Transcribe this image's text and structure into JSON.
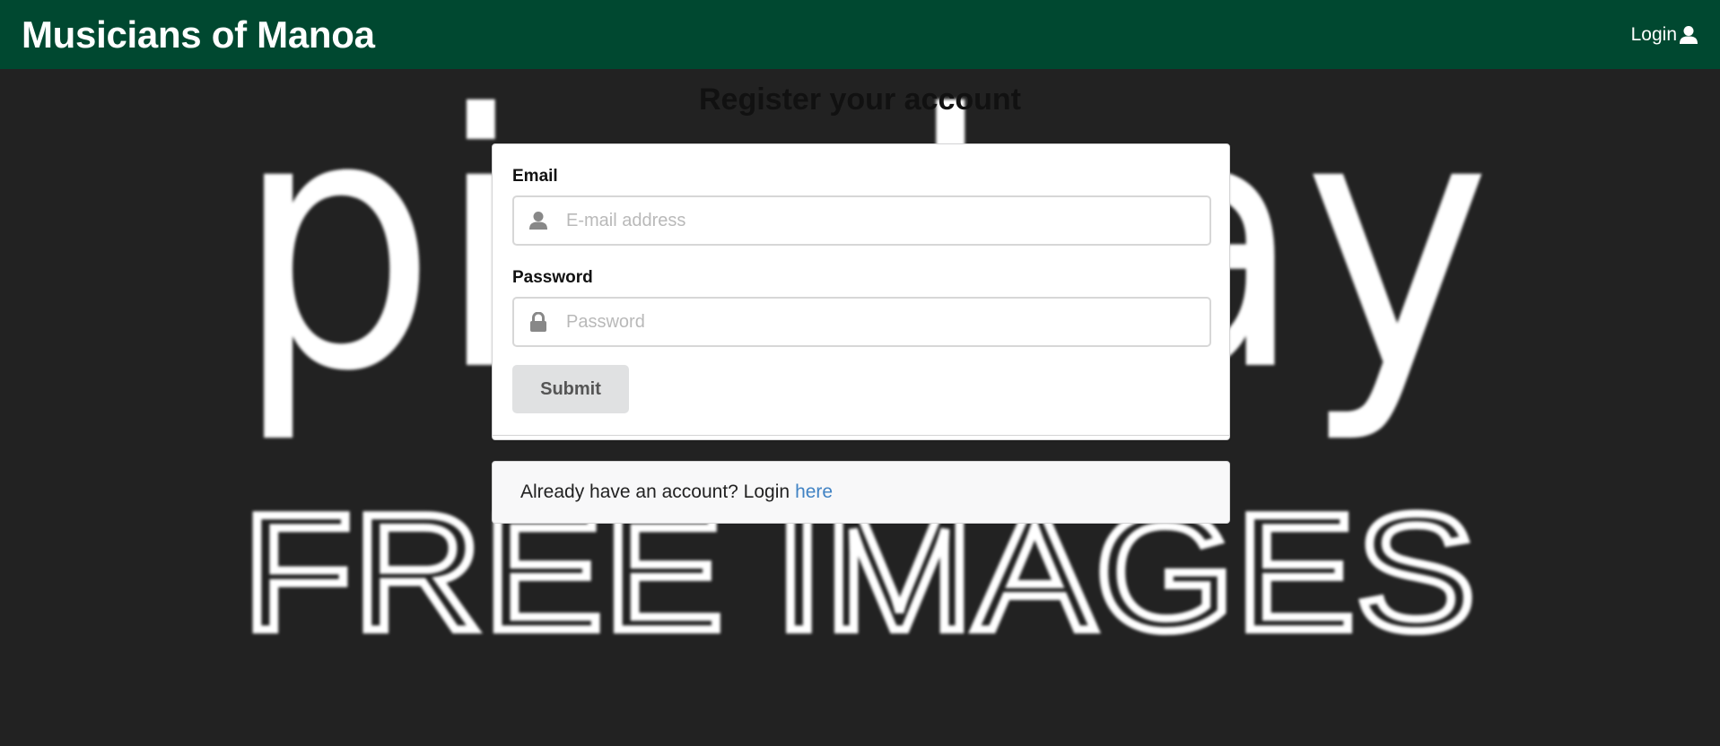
{
  "navbar": {
    "brand": "Musicians of Manoa",
    "login_label": "Login"
  },
  "background": {
    "watermark_top": "pixabay",
    "watermark_bottom": "FREE IMAGES"
  },
  "page": {
    "title": "Register your account"
  },
  "form": {
    "email_label": "Email",
    "email_placeholder": "E-mail address",
    "email_value": "",
    "password_label": "Password",
    "password_placeholder": "Password",
    "password_value": "",
    "submit_label": "Submit"
  },
  "footer_message": {
    "text": "Already have an account? Login",
    "link_text": "here"
  },
  "colors": {
    "navbar": "#004830",
    "background": "#222222",
    "link": "#4183c4",
    "button": "#e0e1e2"
  }
}
